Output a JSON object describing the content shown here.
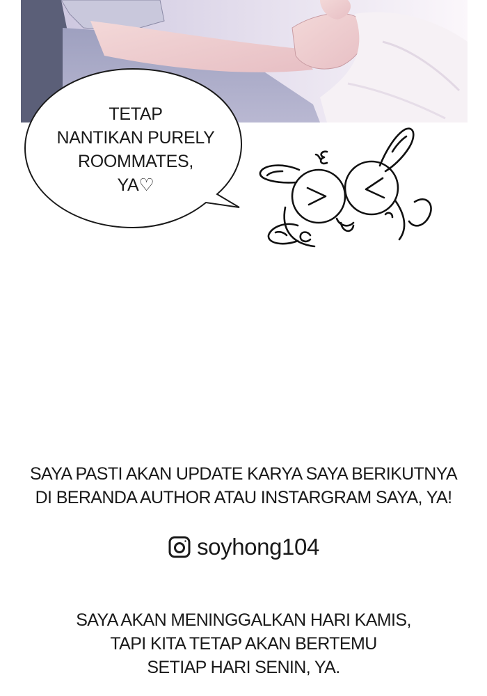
{
  "panel": {
    "speech_bubble": "TETAP\nNANTIKAN PURELY\nROOMMATES,\nYA♡"
  },
  "doodle": {
    "icon": "rabbit-doodle-icon"
  },
  "notices": {
    "update_notice": "SAYA PASTI AKAN UPDATE KARYA SAYA BERIKUTNYA\nDI BERANDA AUTHOR ATAU INSTARGRAM SAYA, YA!",
    "instagram_handle": "soyhong104",
    "instagram_icon": "instagram-icon",
    "schedule_notice": "SAYA AKAN MENINGGALKAN HARI KAMIS,\nTAPI KITA TETAP AKAN BERTEMU\nSETIAP HARI SENIN, YA."
  }
}
